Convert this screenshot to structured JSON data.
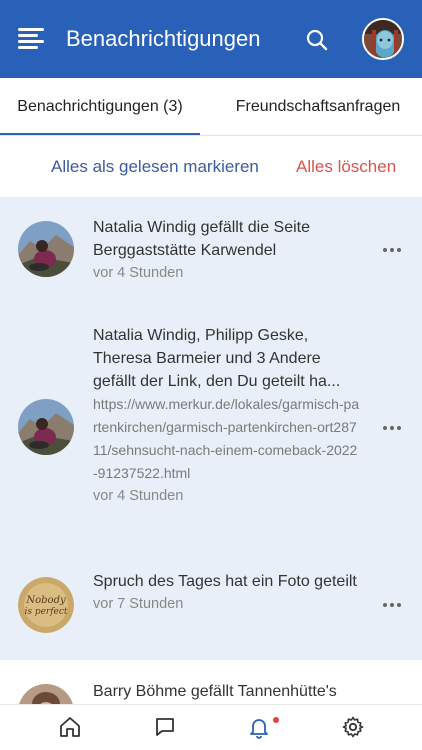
{
  "header": {
    "title": "Benachrichtigungen",
    "menu_icon": "hamburger-menu-icon",
    "search_icon": "search-icon",
    "profile_icon": "profile-avatar",
    "bg_color": "#2960b8"
  },
  "tabs": [
    {
      "label": "Benachrichtigungen (3)",
      "active": true
    },
    {
      "label": "Freundschaftsanfragen",
      "active": false
    }
  ],
  "actions": {
    "mark_read": "Alles als gelesen markieren",
    "delete_all": "Alles löschen"
  },
  "notifications": [
    {
      "message": "Natalia Windig gefällt die Seite Berggaststätte Karwendel",
      "time": "vor 4 Stunden",
      "avatar": "natalia-avatar",
      "unread": true
    },
    {
      "message": "Natalia Windig, Philipp Geske, Theresa Barmeier und 3 Andere gefällt der Link, den Du geteilt ha...",
      "link": "https://www.merkur.de/lokales/garmisch-partenkirchen/garmisch-partenkirchen-ort28711/sehnsucht-nach-einem-comeback-2022-91237522.html",
      "time": "vor 4 Stunden",
      "avatar": "natalia-avatar",
      "unread": true
    },
    {
      "message": "Spruch des Tages hat ein Foto geteilt",
      "time": "vor 7 Stunden",
      "avatar": "nobody-is-perfect-avatar",
      "avatar_text_1": "Nobody",
      "avatar_text_2": "is perfect",
      "unread": true
    },
    {
      "message": "Barry Böhme gefällt Tannenhütte's",
      "avatar": "barry-avatar",
      "unread": false
    }
  ],
  "bottom_nav": [
    {
      "icon": "home-icon"
    },
    {
      "icon": "chat-icon"
    },
    {
      "icon": "bell-icon",
      "active": true,
      "badge": true
    },
    {
      "icon": "settings-gear-icon"
    }
  ],
  "colors": {
    "accent": "#2960b8",
    "danger": "#d9534f",
    "unread_bg": "#e8eff8",
    "link_blue": "#3c5d9c"
  }
}
